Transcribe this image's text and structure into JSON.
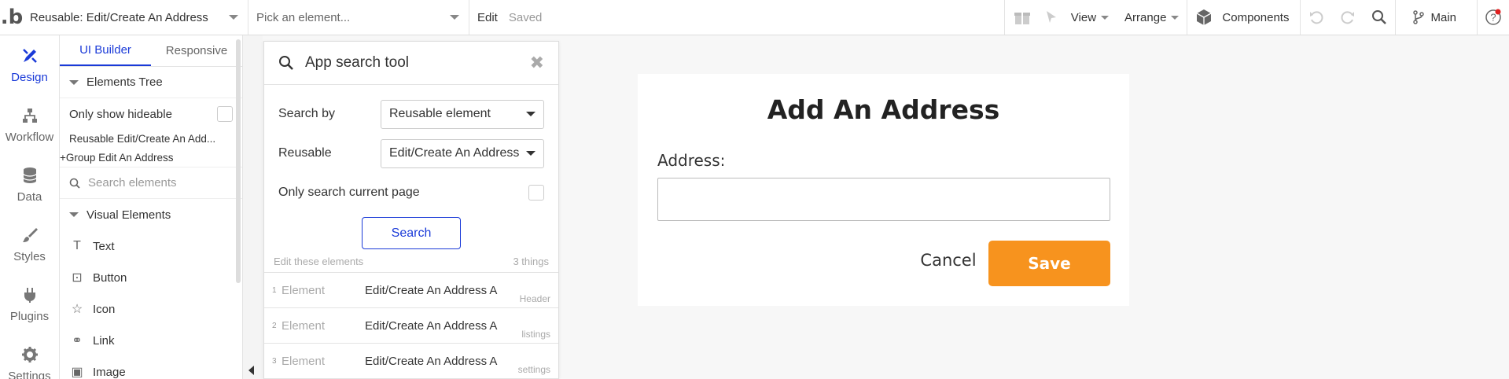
{
  "topbar": {
    "logo": ".b",
    "page_selector": "Reusable: Edit/Create An Address",
    "element_picker": "Pick an element...",
    "edit_label": "Edit",
    "saved_label": "Saved",
    "view_label": "View",
    "arrange_label": "Arrange",
    "components_label": "Components",
    "branch_label": "Main"
  },
  "rail": {
    "items": [
      {
        "label": "Design",
        "icon": "design-icon"
      },
      {
        "label": "Workflow",
        "icon": "workflow-icon"
      },
      {
        "label": "Data",
        "icon": "database-icon"
      },
      {
        "label": "Styles",
        "icon": "brush-icon"
      },
      {
        "label": "Plugins",
        "icon": "plug-icon"
      },
      {
        "label": "Settings",
        "icon": "gear-icon"
      }
    ]
  },
  "panel": {
    "tabs": [
      "UI Builder",
      "Responsive"
    ],
    "tree_header": "Elements Tree",
    "only_hideable_label": "Only show hideable",
    "tree_items": [
      "Reusable Edit/Create An Add...",
      "+Group Edit An Address"
    ],
    "search_placeholder": "Search elements",
    "visual_header": "Visual Elements",
    "visual_items": [
      "Text",
      "Button",
      "Icon",
      "Link",
      "Image"
    ]
  },
  "search_tool": {
    "title": "App search tool",
    "search_by_label": "Search by",
    "search_by_value": "Reusable element",
    "reusable_label": "Reusable",
    "reusable_value": "Edit/Create An Address",
    "current_page_label": "Only search current page",
    "search_button": "Search",
    "results_caption": "Edit these elements",
    "results_count": "3 things",
    "results": [
      {
        "num": "1",
        "type": "Element",
        "name": "Edit/Create An Address A",
        "tag": "Header"
      },
      {
        "num": "2",
        "type": "Element",
        "name": "Edit/Create An Address A",
        "tag": "listings"
      },
      {
        "num": "3",
        "type": "Element",
        "name": "Edit/Create An Address A",
        "tag": "settings"
      }
    ]
  },
  "canvas": {
    "title": "Add An Address",
    "address_label": "Address:",
    "address_value": "",
    "cancel_label": "Cancel",
    "save_label": "Save"
  },
  "colors": {
    "accent": "#1a3ad8",
    "save_button": "#f7931e"
  }
}
